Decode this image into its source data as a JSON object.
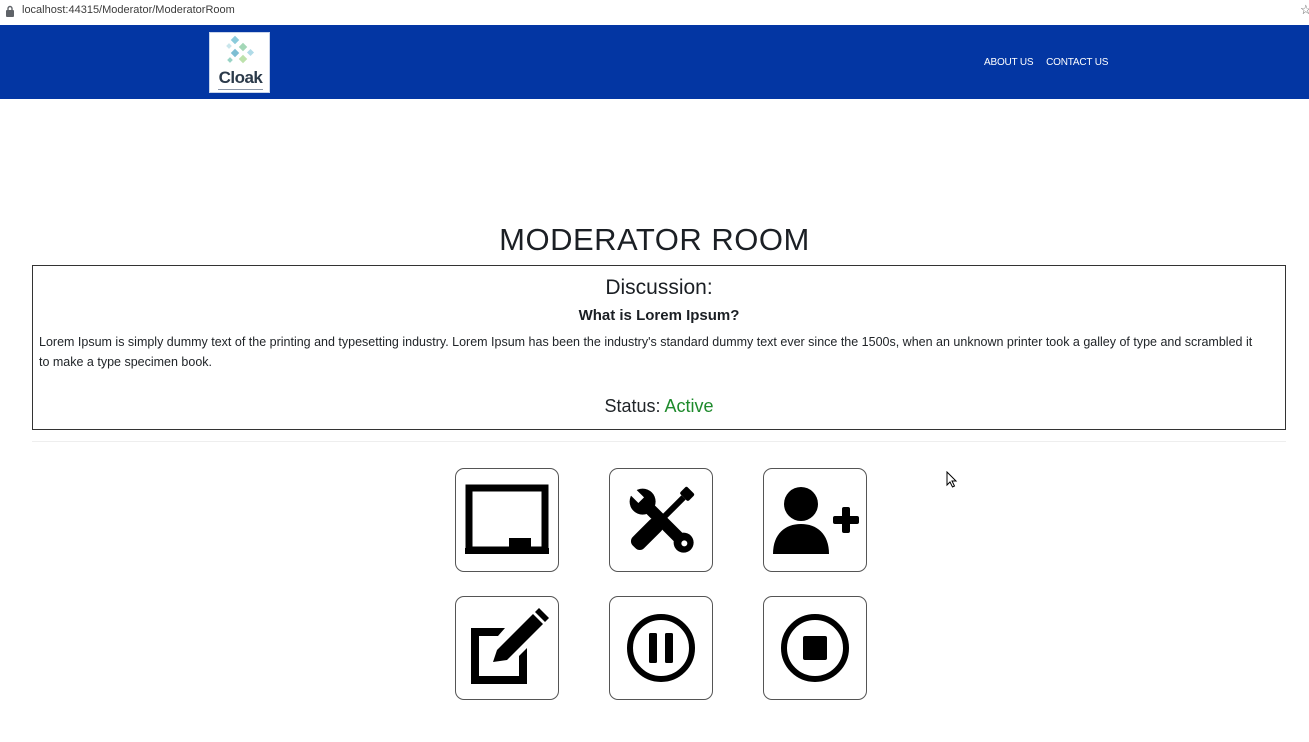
{
  "browser": {
    "url": "localhost:44315/Moderator/ModeratorRoom"
  },
  "navbar": {
    "logo_text": "Cloak",
    "links": [
      "ABOUT US",
      "CONTACT US"
    ],
    "background_color": "#0336a3"
  },
  "page": {
    "title": "MODERATOR ROOM"
  },
  "discussion": {
    "heading": "Discussion:",
    "question": "What is Lorem Ipsum?",
    "body": "Lorem Ipsum is simply dummy text of the printing and typesetting industry. Lorem Ipsum has been the industry's standard dummy text ever since the 1500s, when an unknown printer took a galley of type and scrambled it to make a type specimen book.",
    "status_label": "Status:",
    "status_value": "Active",
    "status_color": "#1e8a2c"
  },
  "actions": [
    {
      "icon": "chalkboard-icon"
    },
    {
      "icon": "tools-icon"
    },
    {
      "icon": "user-plus-icon"
    },
    {
      "icon": "edit-icon"
    },
    {
      "icon": "pause-circle-icon"
    },
    {
      "icon": "stop-circle-icon"
    }
  ]
}
